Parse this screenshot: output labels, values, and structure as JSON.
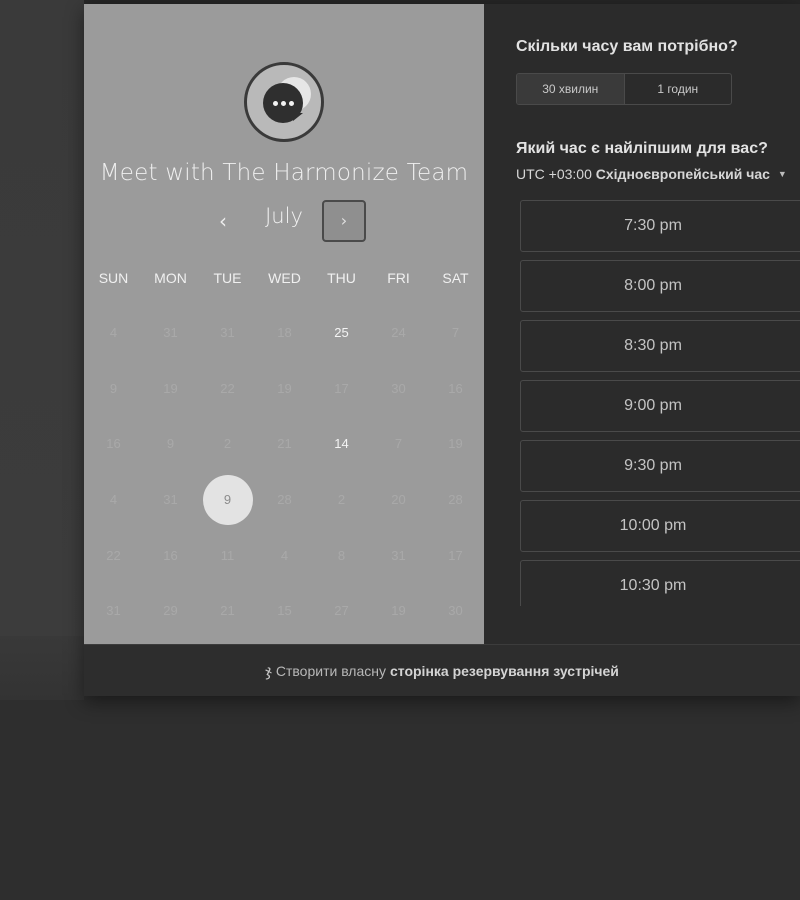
{
  "widget": {
    "title": "Meet with The Harmonize Team",
    "avatar_icon": "chat-bubble-dots-icon"
  },
  "calendar": {
    "month": "July",
    "prev_icon": "‹",
    "next_icon": "›",
    "weekdays": [
      "SUN",
      "MON",
      "TUE",
      "WED",
      "THU",
      "FRI",
      "SAT"
    ],
    "weeks": [
      [
        {
          "d": "4",
          "s": "off"
        },
        {
          "d": "31",
          "s": "off"
        },
        {
          "d": "31",
          "s": "off"
        },
        {
          "d": "18",
          "s": "off"
        },
        {
          "d": "25",
          "s": "avail"
        },
        {
          "d": "24",
          "s": "off"
        },
        {
          "d": "7",
          "s": "off"
        }
      ],
      [
        {
          "d": "9",
          "s": "off"
        },
        {
          "d": "19",
          "s": "off"
        },
        {
          "d": "22",
          "s": "off"
        },
        {
          "d": "19",
          "s": "off"
        },
        {
          "d": "17",
          "s": "off"
        },
        {
          "d": "30",
          "s": "off"
        },
        {
          "d": "16",
          "s": "off"
        }
      ],
      [
        {
          "d": "16",
          "s": "off"
        },
        {
          "d": "9",
          "s": "off"
        },
        {
          "d": "2",
          "s": "off"
        },
        {
          "d": "21",
          "s": "off"
        },
        {
          "d": "14",
          "s": "avail"
        },
        {
          "d": "7",
          "s": "off"
        },
        {
          "d": "19",
          "s": "off"
        }
      ],
      [
        {
          "d": "4",
          "s": "off"
        },
        {
          "d": "31",
          "s": "off"
        },
        {
          "d": "9",
          "s": "selected"
        },
        {
          "d": "28",
          "s": "off"
        },
        {
          "d": "2",
          "s": "off"
        },
        {
          "d": "20",
          "s": "off"
        },
        {
          "d": "28",
          "s": "off"
        }
      ],
      [
        {
          "d": "22",
          "s": "off"
        },
        {
          "d": "16",
          "s": "off"
        },
        {
          "d": "11",
          "s": "off"
        },
        {
          "d": "4",
          "s": "off"
        },
        {
          "d": "8",
          "s": "off"
        },
        {
          "d": "31",
          "s": "off"
        },
        {
          "d": "17",
          "s": "off"
        }
      ],
      [
        {
          "d": "31",
          "s": "off"
        },
        {
          "d": "29",
          "s": "off"
        },
        {
          "d": "21",
          "s": "off"
        },
        {
          "d": "15",
          "s": "off"
        },
        {
          "d": "27",
          "s": "off"
        },
        {
          "d": "19",
          "s": "off"
        },
        {
          "d": "30",
          "s": "off"
        }
      ]
    ]
  },
  "booking": {
    "duration_question": "Скільки часу вам потрібно?",
    "durations": [
      "30 хвилин",
      "1 годин"
    ],
    "selected_duration": "30 хвилин",
    "time_question": "Який час є найліпшим для вас?",
    "tz_offset": "UTC +03:00",
    "tz_name": "Східноєвропейський час",
    "slots": [
      "7:30 pm",
      "8:00 pm",
      "8:30 pm",
      "9:00 pm",
      "9:30 pm",
      "10:00 pm",
      "10:30 pm"
    ]
  },
  "footer": {
    "brand_icon": "hubspot-sprocket-icon",
    "prefix": "Створити власну",
    "link": "сторінка резервування зустрічей"
  }
}
